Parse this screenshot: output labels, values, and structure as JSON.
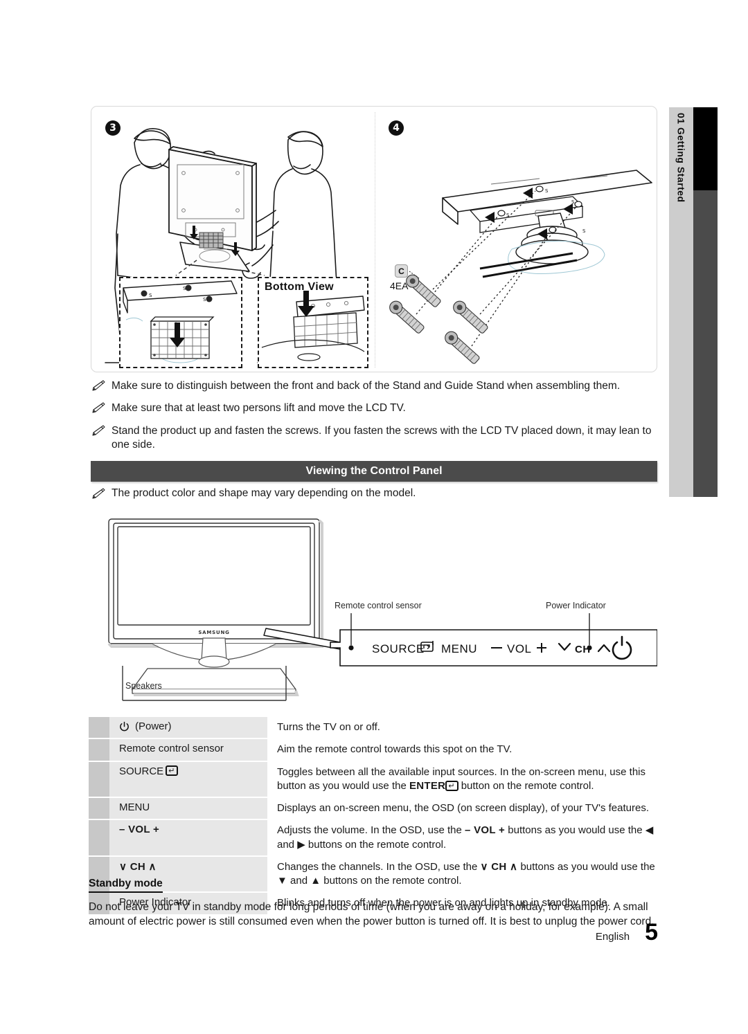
{
  "side_tab": {
    "chapter_number": "01",
    "chapter_title": "Getting Started",
    "label": "01  Getting Started",
    "light_color": "#cdcdcd",
    "black_color": "#000000",
    "dark_color": "#4b4b4b"
  },
  "illustration": {
    "step3_badge": "3",
    "step4_badge": "4",
    "bottom_view_label": "Bottom View",
    "part_label": "C",
    "part_quantity": "4EA",
    "screw_marks": [
      "S",
      "S",
      "S",
      "S"
    ]
  },
  "notes": [
    "Make sure to distinguish between the front and back of the Stand and Guide Stand when assembling them.",
    "Make sure that at least two persons lift and move the LCD TV.",
    "Stand the product up and fasten the screws.  If you fasten the screws with the LCD TV placed down, it may lean to one side."
  ],
  "section": {
    "title": "Viewing the Control Panel",
    "bar_color": "#4b4b4b",
    "note": "The product color and shape may vary depending on the model."
  },
  "diagram": {
    "brand": "SAMSUNG",
    "speakers_label": "Speakers",
    "remote_sensor_label": "Remote control sensor",
    "power_indicator_label": "Power Indicator",
    "panel_buttons": {
      "source": "SOURCE",
      "menu": "MENU",
      "vol_minus": "–",
      "vol": "VOL",
      "vol_plus": "+",
      "ch_down": "∨",
      "ch": "CH",
      "ch_up": "∧",
      "power_icon": "power-icon"
    }
  },
  "table": {
    "rows": [
      {
        "key": "(Power)",
        "key_icon": "power-icon",
        "key_style": "icon-plain",
        "desc": "Turns the TV on or off."
      },
      {
        "key": "Remote control sensor",
        "key_style": "plain",
        "desc": "Aim the remote control towards this spot on the TV."
      },
      {
        "key": "SOURCE",
        "key_icon": "enter-glyph",
        "key_style": "plain-with-enter",
        "desc_line1": "Toggles between all the available input sources. In the on-screen menu, use this",
        "desc_line2_a": "button as you would use the ",
        "desc_line2_enter": "ENTER",
        "desc_line2_b": " button on the remote control."
      },
      {
        "key": "MENU",
        "key_style": "plain",
        "desc": "Displays an on-screen menu, the OSD (on screen display), of your TV's features."
      },
      {
        "key": "– VOL +",
        "key_style": "bold",
        "desc_line1_a": "Adjusts the volume. In the OSD, use the ",
        "desc_line1_b": "– VOL +",
        "desc_line1_c": " buttons as you would use the ◀",
        "desc_line2": "and ▶ buttons on the remote control."
      },
      {
        "key": "∨ CH ∧",
        "key_style": "bold",
        "desc_line1_a": "Changes the channels. In the OSD, use the ",
        "desc_line1_b": "∨ CH ∧",
        "desc_line1_c": " buttons as you would use the",
        "desc_line2": "▼ and ▲ buttons on the remote control."
      },
      {
        "key": "Power Indicator",
        "key_style": "plain",
        "desc": "Blinks and turns off when the power is on and lights up in standby mode."
      }
    ],
    "swatch_color": "#c8c8c8",
    "key_cell_color": "#e7e7e7"
  },
  "standby": {
    "heading": "Standby mode",
    "body": "Do not leave your TV in standby mode for long periods of time (when you are away on a holiday, for example). A small amount of electric power is still consumed even when the power button is turned off. It is best to unplug the power cord."
  },
  "footer": {
    "language": "English",
    "page_number": "5"
  }
}
